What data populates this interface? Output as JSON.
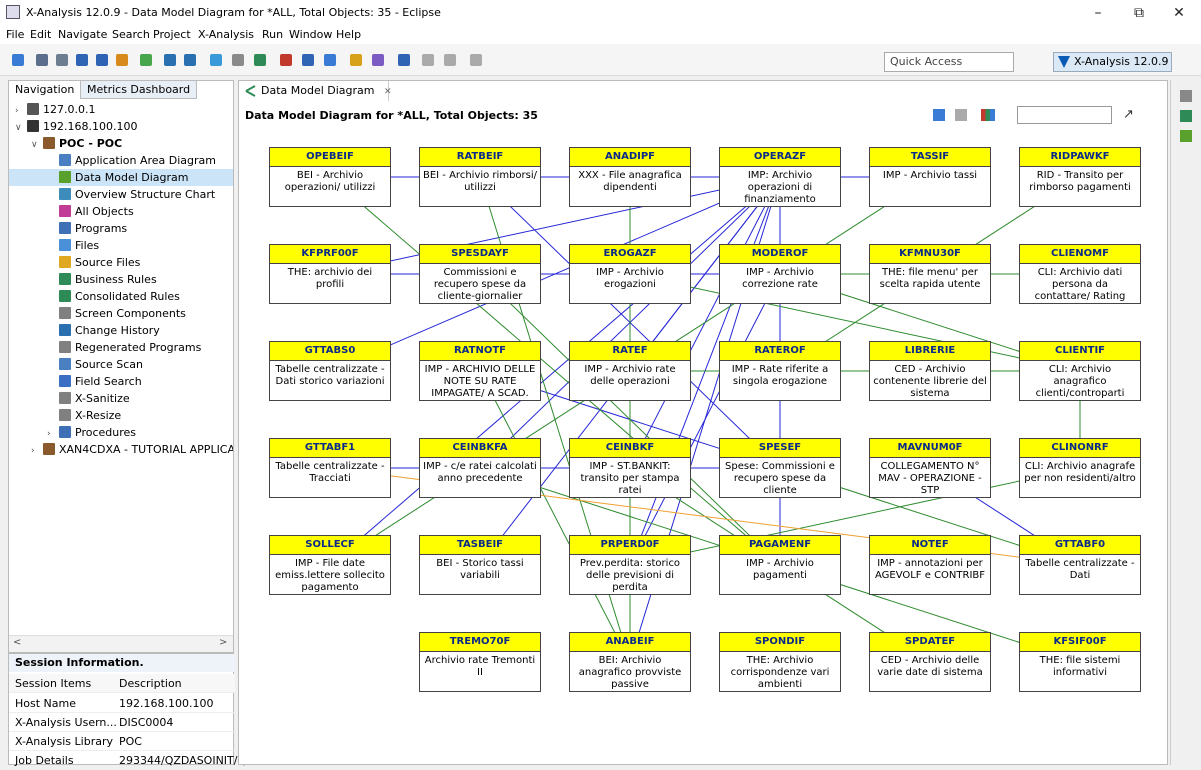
{
  "window": {
    "title": "X-Analysis 12.0.9 - Data Model Diagram for *ALL, Total Objects: 35 - Eclipse",
    "minimize": "–",
    "restore": "⧉",
    "close": "✕"
  },
  "menu": [
    "File",
    "Edit",
    "Navigate",
    "Search",
    "Project",
    "X-Analysis",
    "Run",
    "Window",
    "Help"
  ],
  "toolbar": {
    "quick_access": "Quick Access",
    "perspective_label": "X-Analysis 12.0.9",
    "icons": [
      "new-icon",
      "save-icon",
      "print-icon",
      "properties-icon",
      "run-icon",
      "debug-icon",
      "refresh-icon",
      "back-icon",
      "forward-icon",
      "search-icon",
      "settings-icon",
      "tools-icon"
    ]
  },
  "navigation": {
    "tab_navigation": "Navigation",
    "tab_metrics": "Metrics Dashboard",
    "tree": [
      {
        "label": "127.0.0.1",
        "twisty": "›",
        "icon_color": "#555555"
      },
      {
        "label": "192.168.100.100",
        "twisty": "∨",
        "icon_color": "#333333"
      },
      {
        "label": "POC - POC",
        "twisty": "∨",
        "icon_color": "#8a5a2b",
        "bold": true
      },
      {
        "label": "Application Area Diagram",
        "icon_color": "#4a7fc1"
      },
      {
        "label": "Data Model Diagram",
        "icon_color": "#5aa02c",
        "selected": true
      },
      {
        "label": "Overview Structure Chart",
        "icon_color": "#3c8dbc"
      },
      {
        "label": "All Objects",
        "icon_color": "#c03c96"
      },
      {
        "label": "Programs",
        "icon_color": "#3f6fb5"
      },
      {
        "label": "Files",
        "icon_color": "#4a90d9"
      },
      {
        "label": "Source Files",
        "icon_color": "#e0a820"
      },
      {
        "label": "Business Rules",
        "icon_color": "#2e8b57"
      },
      {
        "label": "Consolidated Rules",
        "icon_color": "#2e8b57"
      },
      {
        "label": "Screen Components",
        "icon_color": "#808080"
      },
      {
        "label": "Change History",
        "icon_color": "#2a6fb0"
      },
      {
        "label": "Regenerated Programs",
        "icon_color": "#808080"
      },
      {
        "label": "Source Scan",
        "icon_color": "#4a7fc1"
      },
      {
        "label": "Field Search",
        "icon_color": "#3b6fc4"
      },
      {
        "label": "X-Sanitize",
        "icon_color": "#808080"
      },
      {
        "label": "X-Resize",
        "icon_color": "#808080"
      },
      {
        "label": "Procedures",
        "twisty": "›",
        "icon_color": "#3f6fb5"
      },
      {
        "label": "XAN4CDXA - TUTORIAL APPLICA",
        "twisty": "›",
        "icon_color": "#8a5a2b"
      }
    ]
  },
  "session": {
    "title": "Session Information.",
    "col_items": "Session Items",
    "col_desc": "Description",
    "rows": [
      {
        "item": "Host Name",
        "value": "192.168.100.100"
      },
      {
        "item": "X-Analysis Usern...",
        "value": "DISC0004"
      },
      {
        "item": "X-Analysis Library",
        "value": "POC"
      },
      {
        "item": "Job Details",
        "value": "293344/QZDASOINIT/Q"
      }
    ]
  },
  "editor": {
    "tab_label": "Data Model Diagram",
    "tab_close": "✕",
    "diagram_title": "Data Model Diagram for *ALL, Total Objects: 35",
    "find_icon": "↗",
    "colors": {
      "header": "#ffff00",
      "header_text": "#0a2a8a",
      "blue_link": "#2626d8",
      "green_link": "#2e8b2e",
      "orange_link": "#f0a030"
    }
  },
  "entities": [
    {
      "name": "OPEBEIF",
      "desc": "BEI - Archivio operazioni/ utilizzi"
    },
    {
      "name": "RATBEIF",
      "desc": "BEI - Archivio rimborsi/ utilizzi"
    },
    {
      "name": "ANADIPF",
      "desc": "XXX - File anagrafica dipendenti"
    },
    {
      "name": "OPERAZF",
      "desc": "IMP: Archivio operazioni di finanziamento"
    },
    {
      "name": "TASSIF",
      "desc": "IMP - Archivio tassi"
    },
    {
      "name": "RIDPAWKF",
      "desc": "RID - Transito per rimborso pagamenti"
    },
    {
      "name": "KFPRF00F",
      "desc": "THE: archivio dei profili"
    },
    {
      "name": "SPESDAYF",
      "desc": "Commissioni e recupero spese da cliente-giornalier"
    },
    {
      "name": "EROGAZF",
      "desc": "IMP - Archivio erogazioni"
    },
    {
      "name": "MODEROF",
      "desc": "IMP - Archivio correzione rate"
    },
    {
      "name": "KFMNU30F",
      "desc": "THE: file menu' per scelta rapida utente"
    },
    {
      "name": "CLIENOMF",
      "desc": "CLI: Archivio dati persona da contattare/ Rating"
    },
    {
      "name": "GTTABS0",
      "desc": "Tabelle centralizzate - Dati storico variazioni"
    },
    {
      "name": "RATNOTF",
      "desc": "IMP - ARCHIVIO DELLE NOTE SU RATE IMPAGATE/ A SCAD."
    },
    {
      "name": "RATEF",
      "desc": "IMP - Archivio rate delle operazioni"
    },
    {
      "name": "RATEROF",
      "desc": "IMP - Rate riferite a singola erogazione"
    },
    {
      "name": "LIBRERIE",
      "desc": "CED - Archivio contenente librerie del sistema"
    },
    {
      "name": "CLIENTIF",
      "desc": "CLI: Archivio anagrafico clienti/controparti"
    },
    {
      "name": "GTTABF1",
      "desc": "Tabelle centralizzate - Tracciati"
    },
    {
      "name": "CEINBKFA",
      "desc": "IMP - c/e ratei calcolati anno precedente"
    },
    {
      "name": "CEINBKF",
      "desc": "IMP - ST.BANKIT: transito per stampa ratei"
    },
    {
      "name": "SPESEF",
      "desc": "Spese: Commissioni e recupero spese da cliente"
    },
    {
      "name": "MAVNUM0F",
      "desc": "COLLEGAMENTO N° MAV - OPERAZIONE - STP"
    },
    {
      "name": "CLINONRF",
      "desc": "CLI: Archivio anagrafe per non residenti/altro"
    },
    {
      "name": "SOLLECF",
      "desc": "IMP - File date emiss.lettere sollecito pagamento"
    },
    {
      "name": "TASBEIF",
      "desc": "BEI - Storico tassi variabili"
    },
    {
      "name": "PRPERD0F",
      "desc": "Prev.perdita: storico delle previsioni di perdita"
    },
    {
      "name": "PAGAMENF",
      "desc": "IMP - Archivio pagamenti"
    },
    {
      "name": "NOTEF",
      "desc": "IMP - annotazioni per AGEVOLF e CONTRIBF"
    },
    {
      "name": "GTTABF0",
      "desc": "Tabelle centralizzate - Dati"
    },
    {
      "name": "TREMO70F",
      "desc": "Archivio rate Tremonti II"
    },
    {
      "name": "ANABEIF",
      "desc": "BEI: Archivio anagrafico provviste passive"
    },
    {
      "name": "SPONDIF",
      "desc": "THE: Archivio corrispondenze vari ambienti"
    },
    {
      "name": "SPDATEF",
      "desc": "CED - Archivio delle varie date di sistema"
    },
    {
      "name": "KFSIF00F",
      "desc": "THE: file sistemi informativi"
    }
  ]
}
